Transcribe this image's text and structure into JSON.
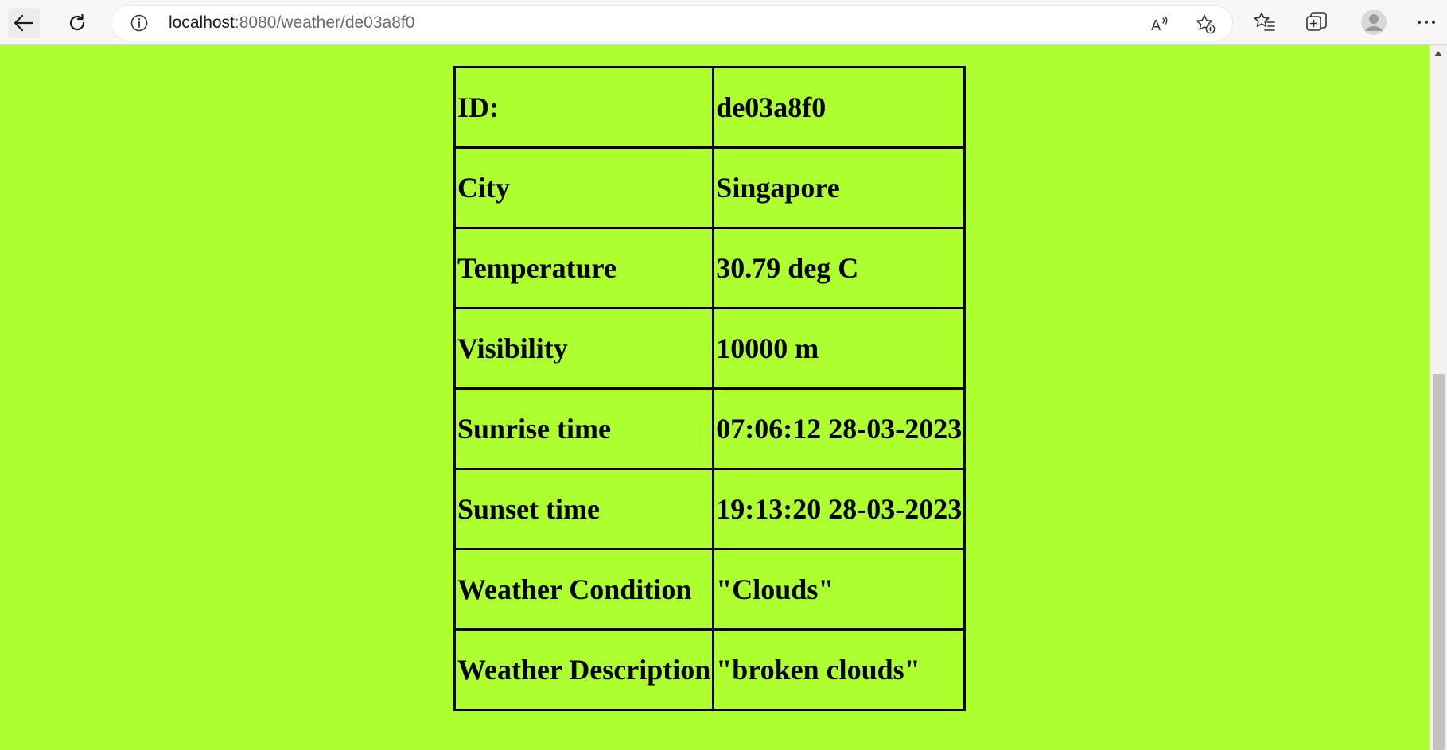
{
  "browser": {
    "url_host": "localhost",
    "url_path": ":8080/weather/de03a8f0",
    "icons": [
      "back-arrow-icon",
      "refresh-icon",
      "info-icon",
      "read-aloud-icon",
      "add-favorite-icon",
      "favorites-icon",
      "collections-icon",
      "profile-icon",
      "more-icon"
    ]
  },
  "page": {
    "background_color": "#adff2f",
    "rows": [
      {
        "label": "ID:",
        "value": "de03a8f0"
      },
      {
        "label": "City",
        "value": "Singapore"
      },
      {
        "label": "Temperature",
        "value": "30.79 deg C"
      },
      {
        "label": "Visibility",
        "value": "10000 m"
      },
      {
        "label": "Sunrise time",
        "value": "07:06:12 28-03-2023"
      },
      {
        "label": "Sunset time",
        "value": "19:13:20 28-03-2023"
      },
      {
        "label": "Weather Condition",
        "value": "\"Clouds\""
      },
      {
        "label": "Weather Description",
        "value": "\"broken clouds\""
      }
    ]
  }
}
